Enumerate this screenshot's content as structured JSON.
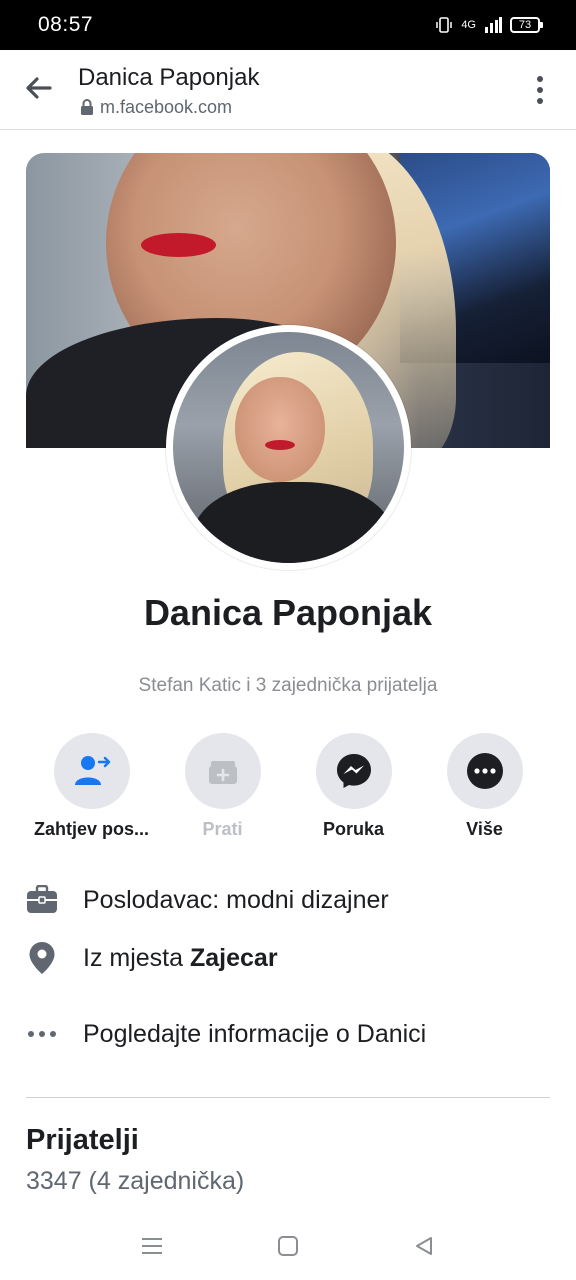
{
  "status_bar": {
    "time": "08:57",
    "network": "4G",
    "battery": "73"
  },
  "browser": {
    "title": "Danica Paponjak",
    "url": "m.facebook.com"
  },
  "profile": {
    "name": "Danica Paponjak",
    "mutual_friends_text": "Stefan Katic i 3 zajednička prijatelja"
  },
  "actions": [
    {
      "label": "Zahtjev pos...",
      "icon": "add-friend-icon",
      "enabled": true
    },
    {
      "label": "Prati",
      "icon": "follow-icon",
      "enabled": false
    },
    {
      "label": "Poruka",
      "icon": "messenger-icon",
      "enabled": true
    },
    {
      "label": "Više",
      "icon": "more-icon",
      "enabled": true
    }
  ],
  "info": {
    "work": "Poslodavac: modni dizajner",
    "location_prefix": "Iz mjesta ",
    "location_city": "Zajecar",
    "about_link": "Pogledajte informacije o Danici"
  },
  "friends": {
    "title": "Prijatelji",
    "count": "3347 (4 zajednička)"
  },
  "colors": {
    "accent": "#1877f2",
    "text": "#1c1e21",
    "secondary_text": "#606770",
    "button_bg": "#e4e6eb"
  }
}
